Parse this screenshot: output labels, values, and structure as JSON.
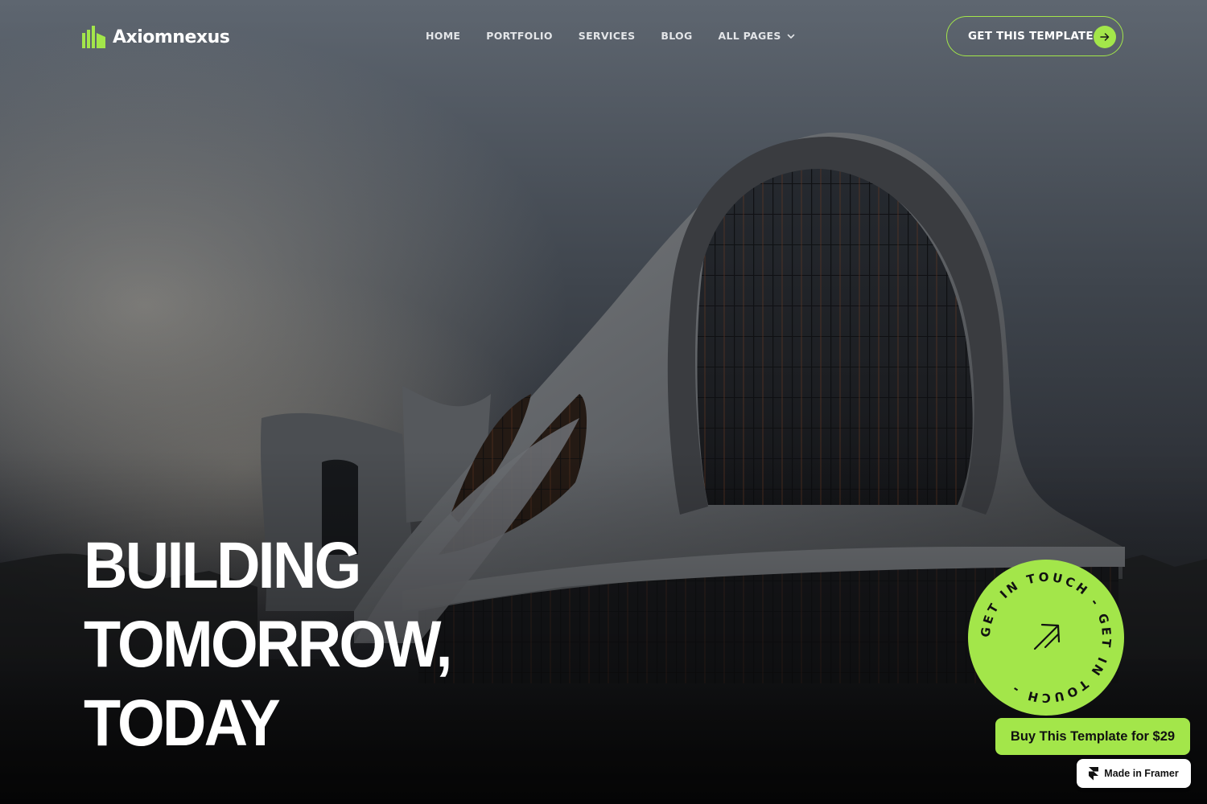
{
  "brand": {
    "name": "Axiomnexus",
    "logo_icon": "building-bars-icon"
  },
  "nav": {
    "items": [
      {
        "label": "HOME"
      },
      {
        "label": "PORTFOLIO"
      },
      {
        "label": "SERVICES"
      },
      {
        "label": "BLOG"
      },
      {
        "label": "ALL PAGES",
        "icon": "chevron-down-icon"
      }
    ]
  },
  "header_cta": {
    "label": "GET THIS TEMPLATE",
    "icon": "arrow-right-icon"
  },
  "hero": {
    "headline_lines": [
      "BUILDING",
      "TOMORROW,",
      "TODAY"
    ],
    "background": "futuristic-curved-building-photo"
  },
  "touch_badge": {
    "ring_text": "GET IN TOUCH - GET IN TOUCH - ",
    "icon": "arrow-up-right-icon"
  },
  "buy_button": {
    "label": "Buy This Template for $29"
  },
  "framer_badge": {
    "label": "Made in Framer",
    "icon": "framer-logo-icon"
  },
  "colors": {
    "accent": "#a3e64a",
    "text": "#ffffff",
    "background_dark": "#0f1012"
  }
}
